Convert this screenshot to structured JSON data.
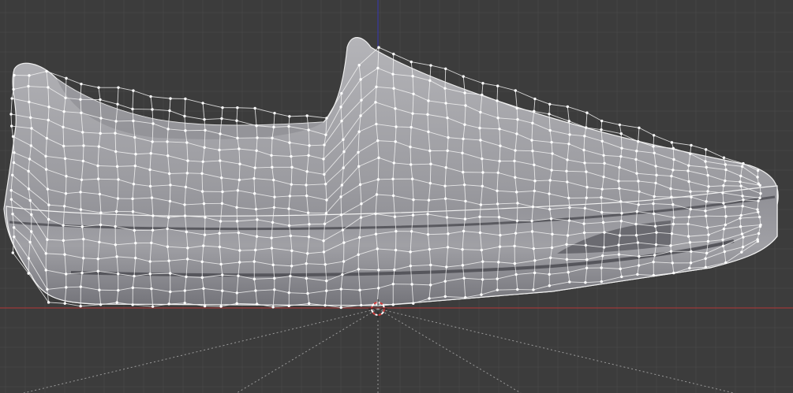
{
  "viewport": {
    "background": "#3c3c3c",
    "grid_minor_color": "#454545",
    "grid_major_color": "#4a4a4a",
    "x_axis_color": "#8c3a3a",
    "z_axis_color": "#3a3a8c"
  },
  "mesh": {
    "object": "slip-on shoe",
    "fill_light": "#a9a9ad",
    "fill_dark": "#6d6d72",
    "wire_color": "#f2f2f2",
    "vertex_color": "#ffffff"
  },
  "scene": {
    "origin_marker": "3d-cursor",
    "cursor_ring_colors": [
      "#d23c3c",
      "#ffffff"
    ]
  }
}
